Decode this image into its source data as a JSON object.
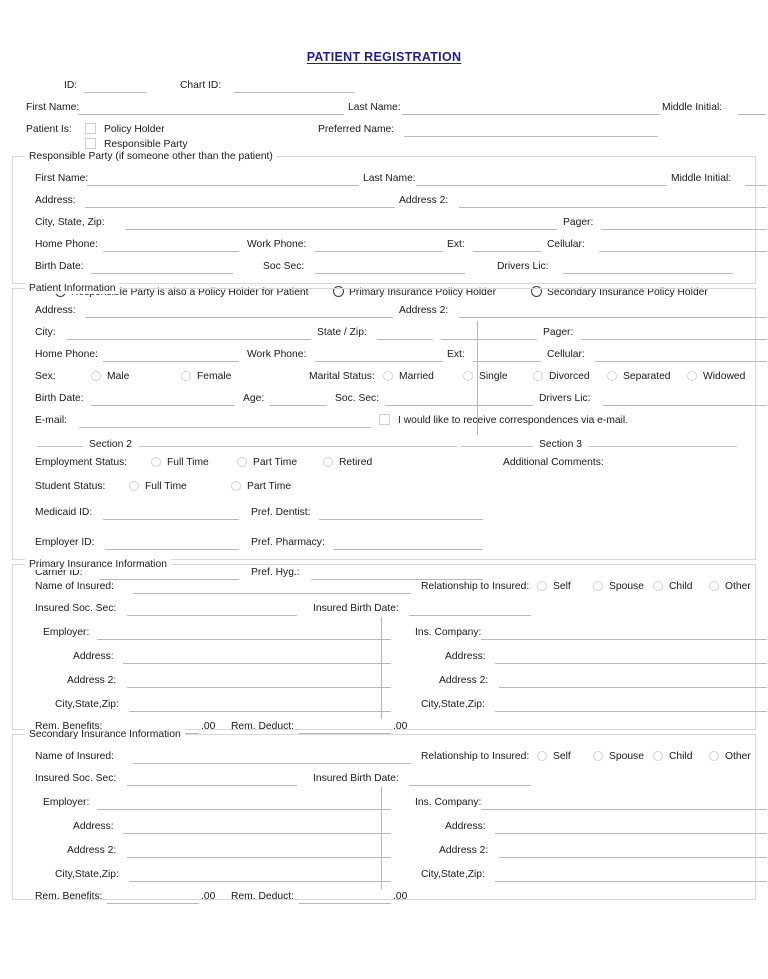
{
  "document": {
    "title": "PATIENT REGISTRATION",
    "title_color": "#1f1f8c"
  },
  "header_fields": {
    "id_label": "ID:",
    "chart_id_label": "Chart ID:",
    "first_name_label": "First Name:",
    "last_name_label": "Last Name:",
    "middle_initial_label": "Middle Initial:",
    "patient_is_label": "Patient Is:",
    "policy_holder_label": "Policy Holder",
    "responsible_party_label": "Responsible Party",
    "preferred_name_label": "Preferred Name:"
  },
  "responsible_party": {
    "legend": "Responsible Party (if someone other than the patient)",
    "first_name_label": "First Name:",
    "last_name_label": "Last Name:",
    "middle_initial_label": "Middle Initial:",
    "address_label": "Address:",
    "address2_label": "Address 2:",
    "city_state_zip_label": "City, State, Zip:",
    "pager_label": "Pager:",
    "home_phone_label": "Home Phone:",
    "work_phone_label": "Work Phone:",
    "ext_label": "Ext:",
    "cellular_label": "Cellular:",
    "birth_date_label": "Birth Date:",
    "soc_sec_label": "Soc Sec:",
    "drivers_lic_label": "Drivers Lic:",
    "options": [
      "Responsible Party is also a Policy Holder for Patient",
      "Primary Insurance Policy Holder",
      "Secondary Insurance Policy Holder"
    ]
  },
  "patient_information": {
    "legend": "Patient Information",
    "address_label": "Address:",
    "address2_label": "Address 2:",
    "city_label": "City:",
    "state_zip_label": "State / Zip:",
    "pager_label": "Pager:",
    "home_phone_label": "Home Phone:",
    "work_phone_label": "Work Phone:",
    "ext_label": "Ext:",
    "cellular_label": "Cellular:",
    "sex_label": "Sex:",
    "sex_options": [
      "Male",
      "Female"
    ],
    "marital_status_label": "Marital Status:",
    "marital_options": [
      "Married",
      "Single",
      "Divorced",
      "Separated",
      "Widowed"
    ],
    "birth_date_label": "Birth Date:",
    "age_label": "Age:",
    "soc_sec_label": "Soc. Sec:",
    "drivers_lic_label": "Drivers Lic:",
    "email_label": "E-mail:",
    "email_optin_label": "I would like to receive correspondences via e-mail.",
    "section2": {
      "title": "Section 2",
      "employment_status_label": "Employment Status:",
      "employment_options": [
        "Full Time",
        "Part Time",
        "Retired"
      ],
      "student_status_label": "Student Status:",
      "student_options": [
        "Full Time",
        "Part Time"
      ],
      "medicaid_id_label": "Medicaid ID:",
      "pref_dentist_label": "Pref. Dentist:",
      "employer_id_label": "Employer ID:",
      "pref_pharmacy_label": "Pref. Pharmacy:",
      "carrier_id_label": "Carrier ID:",
      "pref_hyg_label": "Pref. Hyg.:"
    },
    "section3": {
      "title": "Section 3",
      "additional_comments_label": "Additional Comments:"
    }
  },
  "primary_insurance": {
    "legend": "Primary Insurance Information",
    "name_of_insured_label": "Name of Insured:",
    "relationship_label": "Relationship to Insured:",
    "relationship_options": [
      "Self",
      "Spouse",
      "Child",
      "Other"
    ],
    "insured_soc_sec_label": "Insured Soc. Sec:",
    "insured_birth_date_label": "Insured Birth Date:",
    "employer_label": "Employer:",
    "employer_address_label": "Address:",
    "employer_address2_label": "Address 2:",
    "employer_city_state_zip_label": "City,State,Zip:",
    "ins_company_label": "Ins. Company:",
    "ins_address_label": "Address:",
    "ins_address2_label": "Address 2:",
    "ins_city_state_zip_label": "City,State,Zip:",
    "rem_benefits_label": "Rem. Benefits:",
    "rem_benefits_suffix": ".00",
    "rem_deduct_label": "Rem. Deduct:",
    "rem_deduct_suffix": ".00"
  },
  "secondary_insurance": {
    "legend": "Secondary Insurance Information",
    "name_of_insured_label": "Name of Insured:",
    "relationship_label": "Relationship to Insured:",
    "relationship_options": [
      "Self",
      "Spouse",
      "Child",
      "Other"
    ],
    "insured_soc_sec_label": "Insured Soc. Sec:",
    "insured_birth_date_label": "Insured Birth Date:",
    "employer_label": "Employer:",
    "employer_address_label": "Address:",
    "employer_address2_label": "Address 2:",
    "employer_city_state_zip_label": "City,State,Zip:",
    "ins_company_label": "Ins. Company:",
    "ins_address_label": "Address:",
    "ins_address2_label": "Address 2:",
    "ins_city_state_zip_label": "City,State,Zip:",
    "rem_benefits_label": "Rem. Benefits:",
    "rem_benefits_suffix": ".00",
    "rem_deduct_label": "Rem. Deduct:",
    "rem_deduct_suffix": ".00"
  }
}
